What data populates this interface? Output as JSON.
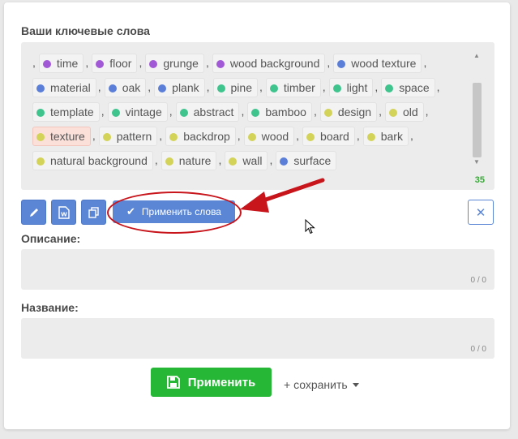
{
  "keywords_section": {
    "label": "Ваши ключевые слова",
    "count": "35",
    "leading_separator": ",",
    "tags": [
      {
        "text": "time",
        "color": "#a259d6"
      },
      {
        "text": "floor",
        "color": "#a259d6"
      },
      {
        "text": "grunge",
        "color": "#a259d6"
      },
      {
        "text": "wood background",
        "color": "#a259d6"
      },
      {
        "text": "wood texture",
        "color": "#5b7fd9"
      },
      {
        "text": "material",
        "color": "#5b7fd9"
      },
      {
        "text": "oak",
        "color": "#5b7fd9"
      },
      {
        "text": "plank",
        "color": "#5b7fd9"
      },
      {
        "text": "pine",
        "color": "#3fc48e"
      },
      {
        "text": "timber",
        "color": "#3fc48e"
      },
      {
        "text": "light",
        "color": "#3fc48e"
      },
      {
        "text": "space",
        "color": "#3fc48e"
      },
      {
        "text": "template",
        "color": "#3fc48e"
      },
      {
        "text": "vintage",
        "color": "#3fc48e"
      },
      {
        "text": "abstract",
        "color": "#3fc48e"
      },
      {
        "text": "bamboo",
        "color": "#3fc48e"
      },
      {
        "text": "design",
        "color": "#d3d35a"
      },
      {
        "text": "old",
        "color": "#d3d35a"
      },
      {
        "text": "texture",
        "color": "#d3d35a",
        "highlighted": true
      },
      {
        "text": "pattern",
        "color": "#d3d35a"
      },
      {
        "text": "backdrop",
        "color": "#d3d35a"
      },
      {
        "text": "wood",
        "color": "#d3d35a"
      },
      {
        "text": "board",
        "color": "#d3d35a"
      },
      {
        "text": "bark",
        "color": "#d3d35a"
      },
      {
        "text": "natural background",
        "color": "#d3d35a"
      },
      {
        "text": "nature",
        "color": "#d3d35a"
      },
      {
        "text": "wall",
        "color": "#d3d35a"
      },
      {
        "text": "surface",
        "color": "#5b7fd9"
      }
    ]
  },
  "toolbar": {
    "edit_icon": "pencil-icon",
    "word_icon": "word-doc-icon",
    "copy_icon": "copy-icon",
    "apply_words_label": "Применить слова",
    "close_icon": "close-icon"
  },
  "description": {
    "label": "Описание:",
    "value": "",
    "counter": "0 / 0"
  },
  "title": {
    "label": "Название:",
    "value": "",
    "counter": "0 / 0"
  },
  "actions": {
    "apply_label": "Применить",
    "save_label": "+ сохранить"
  },
  "colors": {
    "accent_blue": "#5b86d6",
    "primary_green": "#27b737",
    "annotation_red": "#c8141b"
  }
}
